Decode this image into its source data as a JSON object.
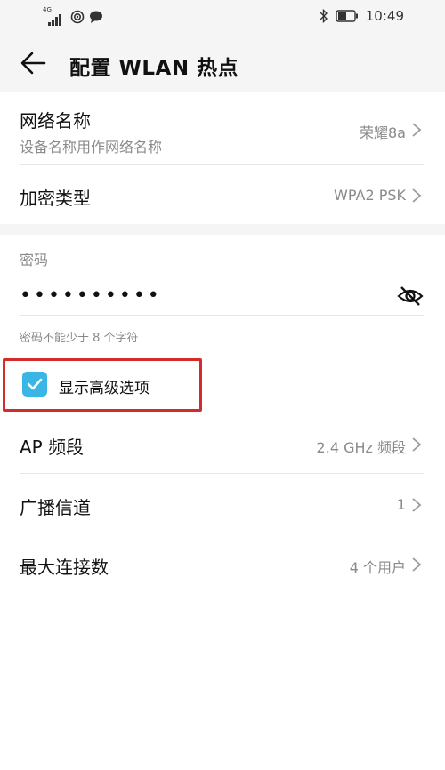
{
  "status_bar": {
    "network_type": "4G",
    "time": "10:49",
    "icons": [
      "signal-icon",
      "hotspot-icon",
      "chat-icon",
      "bluetooth-icon",
      "battery-icon"
    ]
  },
  "header": {
    "title": "配置 WLAN 热点",
    "back_icon": "back-arrow-icon"
  },
  "network_name": {
    "label": "网络名称",
    "sublabel": "设备名称用作网络名称",
    "value": "荣耀8a"
  },
  "encryption": {
    "label": "加密类型",
    "value": "WPA2 PSK"
  },
  "password": {
    "label": "密码",
    "value": "••••••••••",
    "hint": "密码不能少于 8 个字符",
    "visibility_icon": "eye-off-icon"
  },
  "advanced": {
    "label": "显示高级选项",
    "checked": true
  },
  "ap_band": {
    "label": "AP 频段",
    "value": "2.4 GHz 频段"
  },
  "channel": {
    "label": "广播信道",
    "value": "1"
  },
  "max_connections": {
    "label": "最大连接数",
    "value": "4 个用户"
  },
  "colors": {
    "accent": "#39B6E6",
    "highlight": "#D22C2C",
    "secondary_text": "#8A8A8A",
    "background": "#F5F5F5"
  }
}
